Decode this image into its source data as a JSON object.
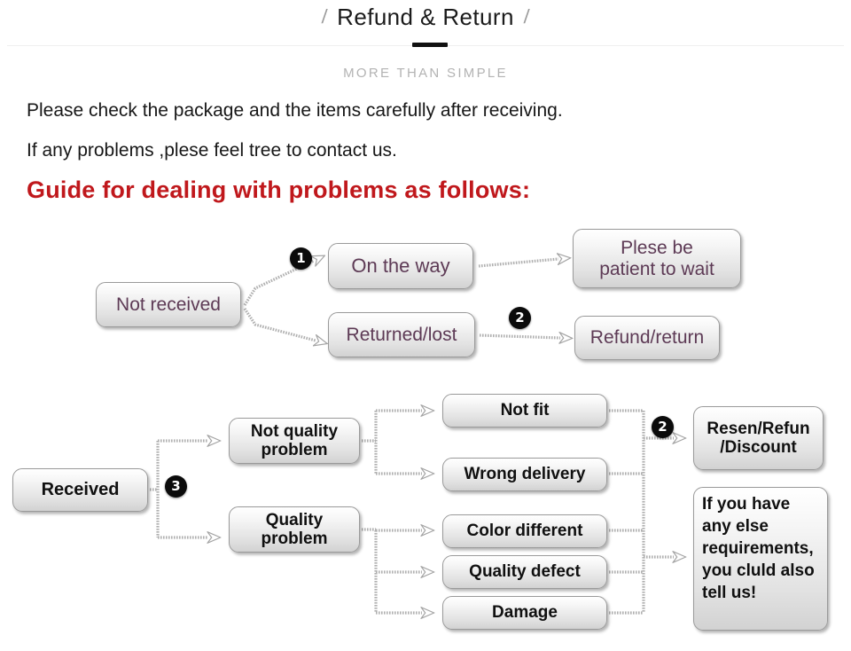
{
  "header": {
    "slash_left": "/",
    "title": "Refund & Return",
    "slash_right": "/",
    "subtitle": "MORE THAN SIMPLE"
  },
  "intro": {
    "line1": "Please check the package and the items carefully after receiving.",
    "line2": "If any problems ,plese feel tree to contact us.",
    "guide_heading": "Guide for dealing with problems as follows:",
    "guide_color": "#c0181c"
  },
  "flow": {
    "section_not_received": {
      "root": "Not received",
      "branches": [
        {
          "label": "On the way",
          "badge": "❶",
          "outcome": "Plese be\npatient to wait"
        },
        {
          "label": "Returned/lost",
          "badge": "❷",
          "outcome": "Refund/return"
        }
      ],
      "outcome_1_line1": "Plese be",
      "outcome_1_line2": "patient to wait",
      "outcome_2": "Refund/return"
    },
    "section_received": {
      "root": "Received",
      "badge_root": "❸",
      "categories": [
        {
          "line1": "Not quality",
          "line2": "problem"
        },
        {
          "line1": "Quality",
          "line2": "problem"
        }
      ],
      "reasons": [
        "Not fit",
        "Wrong delivery",
        "Color different",
        "Quality defect",
        "Damage"
      ],
      "outcomes": [
        {
          "badge": "❷",
          "line1": "Resen/Refun",
          "line2": "/Discount"
        },
        {
          "badge": "",
          "lines": [
            "If you have",
            "any else",
            "requirements,",
            "you cluld also",
            "tell us!"
          ]
        }
      ]
    }
  },
  "colors": {
    "plum_text": "#5d3a55",
    "ink_text": "#101010",
    "box_border": "#9a9a9a",
    "wire": "#a8a8a8",
    "badge_bg": "#0b0b0b"
  }
}
